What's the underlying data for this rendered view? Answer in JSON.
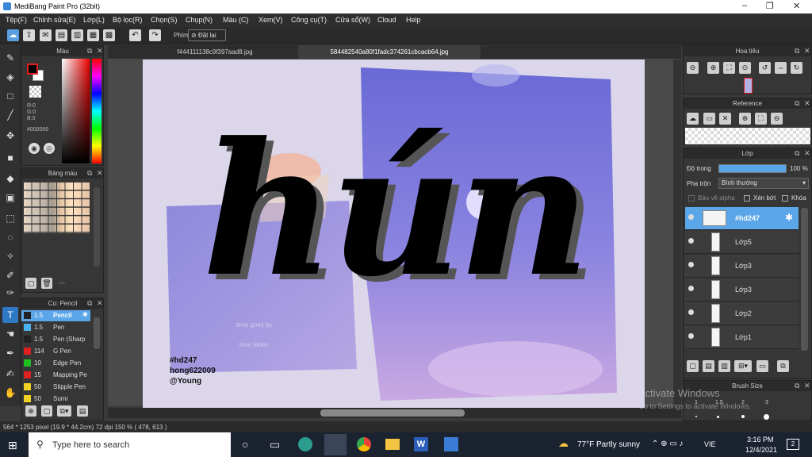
{
  "window": {
    "title": "MediBang Paint Pro (32bit)",
    "min": "–",
    "max": "❐",
    "close": "✕"
  },
  "menu": [
    "Tệp(F)",
    "Chỉnh sửa(E)",
    "Lớp(L)",
    "Bộ lọc(R)",
    "Chọn(S)",
    "Chụp(N)",
    "Màu (C)",
    "Xem(V)",
    "Công cụ(T)",
    "Cửa sổ(W)",
    "Cloud",
    "Help"
  ],
  "toolbar": {
    "shortcut_label": "Phím",
    "reset_label": "Đặt lại"
  },
  "tabs": [
    "f444111138c9f397aad8.jpg",
    "584482540a80f1fadc374261cbcacb64.jpg"
  ],
  "color_panel": {
    "title": "Màu",
    "r": "R:0",
    "g": "G:0",
    "b": "B:0",
    "hex": "#000000"
  },
  "palette_panel": {
    "title": "Bảng màu",
    "footer": "---"
  },
  "brush_panel": {
    "title": "Cọ: Pencil",
    "items": [
      {
        "size": "1.5",
        "name": "Pencil",
        "color": "#222222"
      },
      {
        "size": "1.5",
        "name": "Pen",
        "color": "#4ab4f0"
      },
      {
        "size": "1.5",
        "name": "Pen (Sharp",
        "color": "#222222"
      },
      {
        "size": "114",
        "name": "G Pen",
        "color": "#e02020"
      },
      {
        "size": "10",
        "name": "Edge Pen",
        "color": "#20c020"
      },
      {
        "size": "15",
        "name": "Mapping Pe",
        "color": "#e02020"
      },
      {
        "size": "50",
        "name": "Stipple Pen",
        "color": "#f0d020"
      },
      {
        "size": "50",
        "name": "Sumi",
        "color": "#f0d020"
      }
    ]
  },
  "navigator_panel": {
    "title": "Hoa tiêu"
  },
  "reference_panel": {
    "title": "Reference"
  },
  "layer_panel": {
    "title": "Lớp",
    "opacity_label": "Độ trong",
    "opacity_value": "100 %",
    "opacity": 1.0,
    "blend_label": "Pha trộn",
    "blend_value": "Bình thường",
    "protect_alpha": "Bảo vệ alpha",
    "clipping": "Xén bớt",
    "lock": "Khóa",
    "layers": [
      {
        "name": "#hd247",
        "selected": true
      },
      {
        "name": "Lớp5",
        "selected": false
      },
      {
        "name": "Lớp3",
        "selected": false
      },
      {
        "name": "Lớp3",
        "selected": false
      },
      {
        "name": "Lớp2",
        "selected": false
      },
      {
        "name": "Lớp1",
        "selected": false
      }
    ]
  },
  "brushsize_panel": {
    "title": "Brush Size",
    "sizes": [
      "1",
      "1.5",
      "2",
      "3"
    ]
  },
  "artwork": {
    "word": "hún",
    "credit1": "#hd247",
    "credit2": "hong622009",
    "credit3": "@Young",
    "faint1": "time goes by",
    "faint2": "love fades"
  },
  "watermark": {
    "line1": "Activate Windows",
    "line2": "Go to Settings to activate Windows."
  },
  "status": {
    "text": "564 * 1253 pixel   (19.9 * 44.2cm)   72 dpi   150 %   ( 478, 613 )"
  },
  "taskbar": {
    "search_placeholder": "Type here to search",
    "weather": "77°F  Partly sunny",
    "lang": "VIE",
    "time": "3:16 PM",
    "date": "12/4/2021",
    "notif": "2"
  }
}
